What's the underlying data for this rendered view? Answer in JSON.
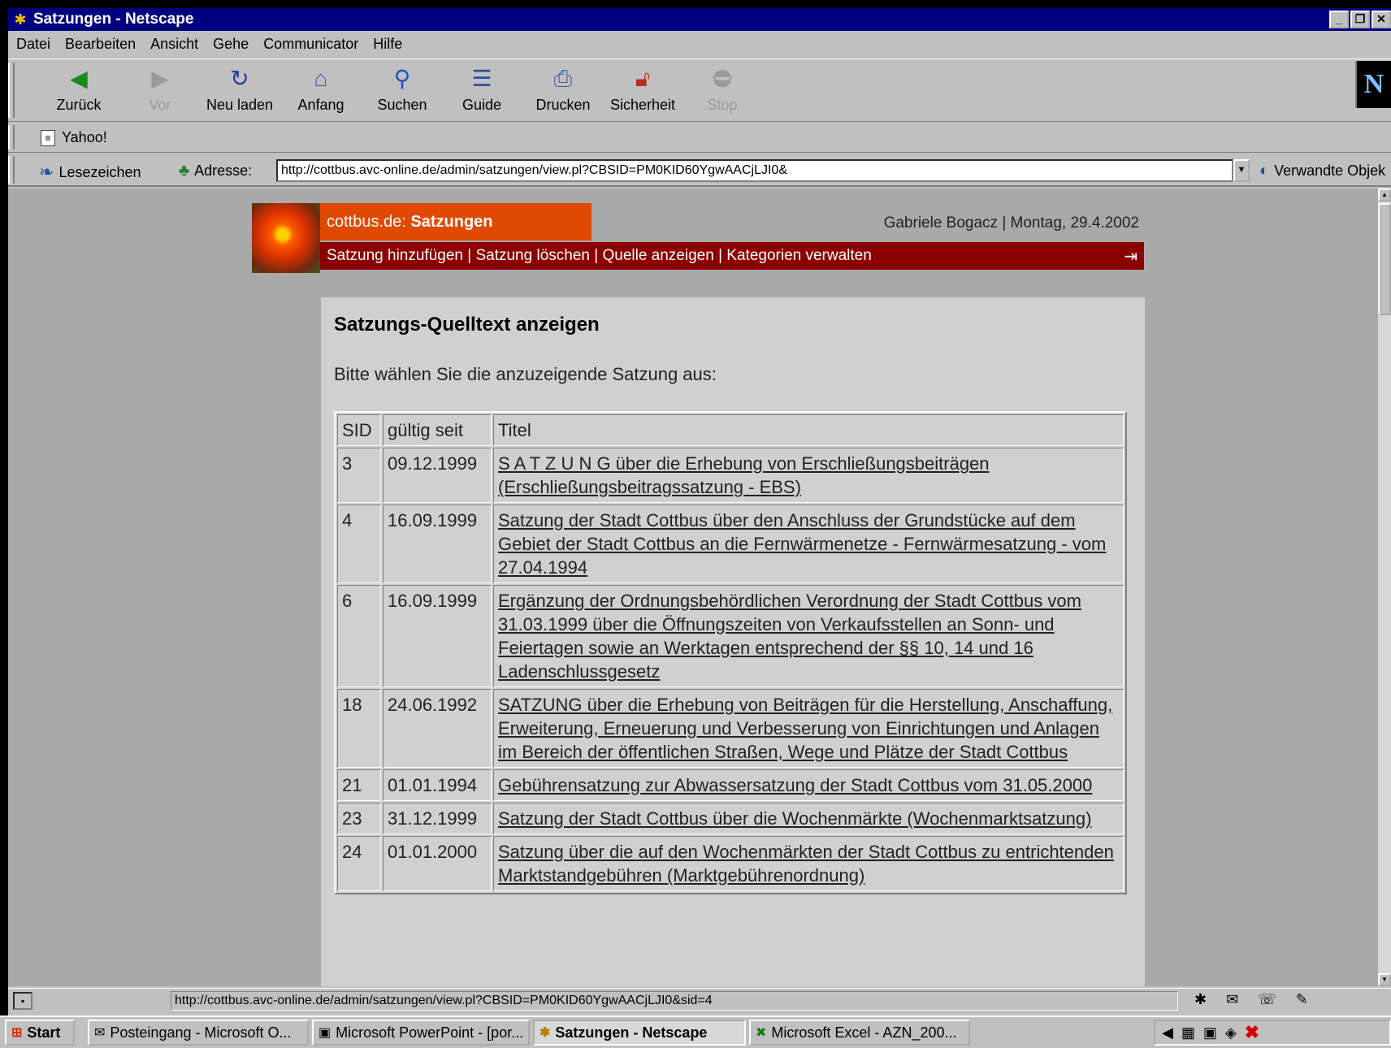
{
  "window": {
    "title": "Satzungen - Netscape",
    "controls": [
      "_",
      "❐",
      "✕"
    ]
  },
  "menu": [
    "Datei",
    "Bearbeiten",
    "Ansicht",
    "Gehe",
    "Communicator",
    "Hilfe"
  ],
  "toolbar": {
    "back": "Zurück",
    "forward": "Vor",
    "reload": "Neu laden",
    "home": "Anfang",
    "search": "Suchen",
    "guide": "Guide",
    "print": "Drucken",
    "security": "Sicherheit",
    "stop": "Stop",
    "logo": "N"
  },
  "personal": {
    "yahoo": "Yahoo!"
  },
  "location": {
    "bookmarks": "Lesezeichen",
    "address_label": "Adresse:",
    "url": "http://cottbus.avc-online.de/admin/satzungen/view.pl?CBSID=PM0KID60YgwAACjLJI0&",
    "related": "Verwandte Objek"
  },
  "site": {
    "brand_prefix": "cottbus.de:",
    "brand_section": "Satzungen",
    "userinfo": "Gabriele Bogacz | Montag, 29.4.2002",
    "nav": [
      "Satzung hinzufügen",
      "Satzung löschen",
      "Quelle anzeigen",
      "Kategorien verwalten"
    ],
    "nav_sep": " | ",
    "exit_icon": "⇥"
  },
  "panel": {
    "heading": "Satzungs-Quelltext anzeigen",
    "intro": "Bitte wählen Sie die anzuzeigende Satzung aus:"
  },
  "table": {
    "headers": [
      "SID",
      "gültig seit",
      "Titel"
    ],
    "rows": [
      [
        "3",
        "09.12.1999",
        "S A T Z U N G über die Erhebung von Erschließungsbeiträgen (Erschließungsbeitragssatzung - EBS)"
      ],
      [
        "4",
        "16.09.1999",
        "Satzung der Stadt Cottbus über den Anschluss der Grundstücke auf dem Gebiet der Stadt Cottbus an die Fernwärmenetze - Fernwärmesatzung - vom 27.04.1994"
      ],
      [
        "6",
        "16.09.1999",
        "Ergänzung der Ordnungsbehördlichen Verordnung der Stadt Cottbus vom 31.03.1999 über die Öffnungszeiten von Verkaufsstellen an Sonn- und Feiertagen sowie an Werktagen entsprechend der §§ 10, 14 und 16 Ladenschlussgesetz"
      ],
      [
        "18",
        "24.06.1992",
        "SATZUNG über die Erhebung von Beiträgen für die Herstellung, Anschaffung, Erweiterung, Erneuerung und Verbesserung von Einrichtungen und Anlagen im Bereich der öffentlichen Straßen, Wege und Plätze der Stadt Cottbus"
      ],
      [
        "21",
        "01.01.1994",
        "Gebührensatzung zur Abwassersatzung der Stadt Cottbus vom 31.05.2000"
      ],
      [
        "23",
        "31.12.1999",
        "Satzung der Stadt Cottbus über die Wochenmärkte (Wochenmarktsatzung)"
      ],
      [
        "24",
        "01.01.2000",
        "Satzung über die auf den Wochenmärkten der Stadt Cottbus zu entrichtenden Marktstandgebühren (Marktgebührenordnung)"
      ]
    ]
  },
  "status": {
    "url": "http://cottbus.avc-online.de/admin/satzungen/view.pl?CBSID=PM0KID60YgwAACjLJI0&sid=4"
  },
  "taskbar": {
    "start": "Start",
    "tasks": [
      "Posteingang - Microsoft O...",
      "Microsoft PowerPoint - [por...",
      "Satzungen - Netscape",
      "Microsoft Excel - AZN_200..."
    ]
  },
  "colors": {
    "brand_orange": "#e04a00",
    "nav_dark_red": "#8b0000",
    "title_blue": "#000080"
  }
}
